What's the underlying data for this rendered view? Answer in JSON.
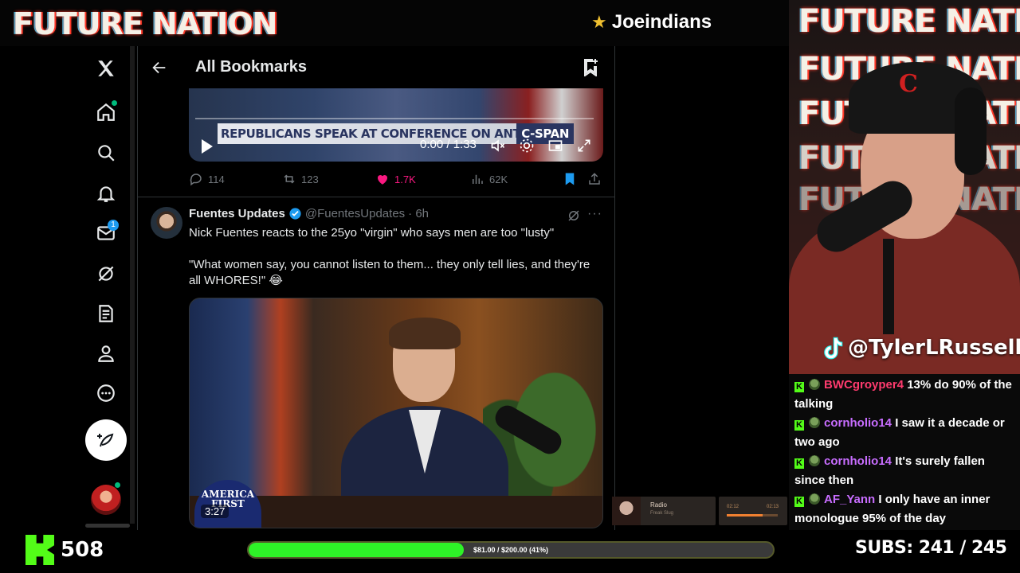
{
  "overlay": {
    "brand": "FUTURE NATION",
    "streamer_name": "Joeindians",
    "cam_bg_lines": [
      "FUTURE NATION",
      "FUTURE NATION",
      "FUTURE NATION",
      "FUTURE NATION",
      "FUTURE NATION"
    ],
    "tiktok_handle": "@TylerLRussell",
    "kick_followers": "508",
    "goal_text": "$81.00 / $200.00 (41%)",
    "goal_progress": 0.41,
    "subs_text": "SUBS:  241 / 245",
    "radio_label": "Radio",
    "radio_sub": "Freak Slug",
    "player_time_start": "02:12",
    "player_time_end": "02:13",
    "accent_green": "#53fc18"
  },
  "twitter": {
    "header_title": "All Bookmarks",
    "nav_icons": [
      "x-logo-icon",
      "home-icon",
      "search-icon",
      "notifications-icon",
      "messages-icon",
      "grok-icon",
      "lists-icon",
      "profile-icon",
      "more-icon"
    ],
    "messages_badge": "1",
    "tweet1": {
      "video_caption": "REPUBLICANS SPEAK AT CONFERENCE ON ANTISEMITISM",
      "video_network": "C-SPAN",
      "video_time": "0:00 / 1:33",
      "replies": "114",
      "reposts": "123",
      "likes": "1.7K",
      "views": "62K"
    },
    "tweet2": {
      "name": "Fuentes Updates",
      "handle": "@FuentesUpdates",
      "time": "· 6h",
      "more": "···",
      "text1": "Nick Fuentes reacts to the 25yo \"virgin\" who says men are too \"lusty\"",
      "text2": "\"What women say, you cannot listen to them... they only tell lies, and they're all WHORES!\" 😂",
      "video_logo": "AMERICA FIRST",
      "video_duration": "3:27"
    }
  },
  "chat": [
    {
      "user": "BWCgroyper4",
      "message": "13% do 90% of the talking",
      "color": "#ff3b6e"
    },
    {
      "user": "cornholio14",
      "message": "I saw it a decade or two ago",
      "color": "#c86dff"
    },
    {
      "user": "cornholio14",
      "message": "It's surely fallen since then",
      "color": "#c86dff"
    },
    {
      "user": "AF_Yann",
      "message": "I only have an inner monologue 95% of the day",
      "color": "#c86dff"
    }
  ]
}
